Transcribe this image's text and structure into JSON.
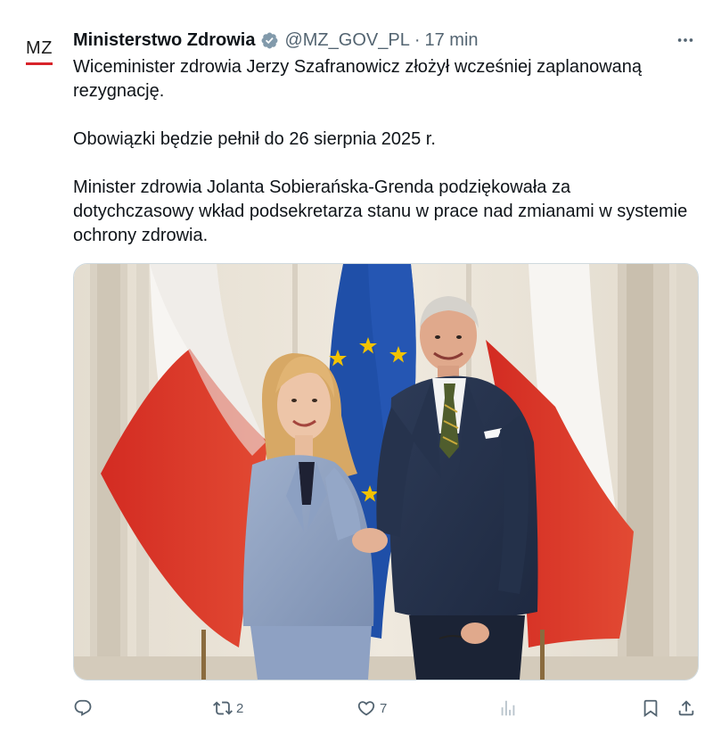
{
  "account": {
    "avatar_text": "MZ",
    "display_name": "Ministerstwo Zdrowia",
    "handle": "@MZ_GOV_PL",
    "separator": "·",
    "timestamp": "17 min",
    "verified_icon": "verified-badge-icon"
  },
  "tweet": {
    "paragraphs": [
      "Wiceminister zdrowia Jerzy Szafranowicz złożył wcześniej zaplanowaną rezygnację.",
      "Obowiązki będzie pełnił do 26 sierpnia 2025 r.",
      "Minister zdrowia Jolanta Sobierańska-Grenda podziękowała za dotychczasowy wkład podsekretarza stanu w prace nad zmianami w systemie ochrony zdrowia."
    ]
  },
  "actions": {
    "reply": {
      "icon": "reply-icon",
      "count": ""
    },
    "retweet": {
      "icon": "retweet-icon",
      "count": "2"
    },
    "like": {
      "icon": "heart-icon",
      "count": "7"
    },
    "views": {
      "icon": "views-icon",
      "count": ""
    },
    "bookmark": {
      "icon": "bookmark-icon"
    },
    "share": {
      "icon": "share-icon"
    }
  },
  "colors": {
    "verified": "#829aab",
    "accent_red": "#d8232a",
    "text_primary": "#0f1419",
    "text_secondary": "#536471",
    "eu_blue": "#1f4fa8",
    "eu_star": "#f2c200"
  }
}
